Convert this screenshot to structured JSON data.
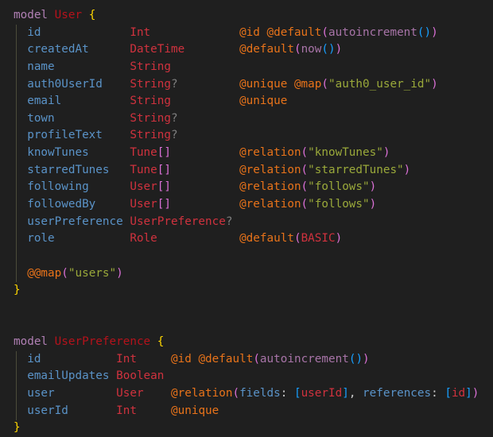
{
  "editor": {
    "language": "prisma",
    "colors": {
      "background": "#1f1f1f",
      "keyword": "#b180b5",
      "model_name": "#b5121b",
      "brace": "#ffd700",
      "field": "#5a93c8",
      "type": "#d0323e",
      "attribute": "#e8731a",
      "string": "#9aa93a",
      "paren_level1": "#da70d6",
      "paren_level2": "#179fff"
    },
    "models": [
      {
        "keyword": "model",
        "name": "User",
        "open": "{",
        "close": "}",
        "fields": [
          {
            "name": "id",
            "type": "Int",
            "mod": "",
            "attr": "@id @default(autoincrement())"
          },
          {
            "name": "createdAt",
            "type": "DateTime",
            "mod": "",
            "attr": "@default(now())"
          },
          {
            "name": "name",
            "type": "String",
            "mod": "",
            "attr": ""
          },
          {
            "name": "auth0UserId",
            "type": "String",
            "mod": "?",
            "attr": "@unique @map(\"auth0_user_id\")"
          },
          {
            "name": "email",
            "type": "String",
            "mod": "",
            "attr": "@unique"
          },
          {
            "name": "town",
            "type": "String",
            "mod": "?",
            "attr": ""
          },
          {
            "name": "profileText",
            "type": "String",
            "mod": "?",
            "attr": ""
          },
          {
            "name": "knowTunes",
            "type": "Tune",
            "mod": "[]",
            "attr": "@relation(\"knowTunes\")"
          },
          {
            "name": "starredTunes",
            "type": "Tune",
            "mod": "[]",
            "attr": "@relation(\"starredTunes\")"
          },
          {
            "name": "following",
            "type": "User",
            "mod": "[]",
            "attr": "@relation(\"follows\")"
          },
          {
            "name": "followedBy",
            "type": "User",
            "mod": "[]",
            "attr": "@relation(\"follows\")"
          },
          {
            "name": "userPreference",
            "type": "UserPreference",
            "mod": "?",
            "attr": ""
          },
          {
            "name": "role",
            "type": "Role",
            "mod": "",
            "attr": "@default(BASIC)"
          }
        ],
        "block_attribute": "@@map(\"users\")"
      },
      {
        "keyword": "model",
        "name": "UserPreference",
        "open": "{",
        "close": "}",
        "fields": [
          {
            "name": "id",
            "type": "Int",
            "mod": "",
            "attr": "@id @default(autoincrement())"
          },
          {
            "name": "emailUpdates",
            "type": "Boolean",
            "mod": "",
            "attr": ""
          },
          {
            "name": "user",
            "type": "User",
            "mod": "",
            "attr": "@relation(fields: [userId], references: [id])"
          },
          {
            "name": "userId",
            "type": "Int",
            "mod": "",
            "attr": "@unique"
          }
        ]
      }
    ]
  }
}
